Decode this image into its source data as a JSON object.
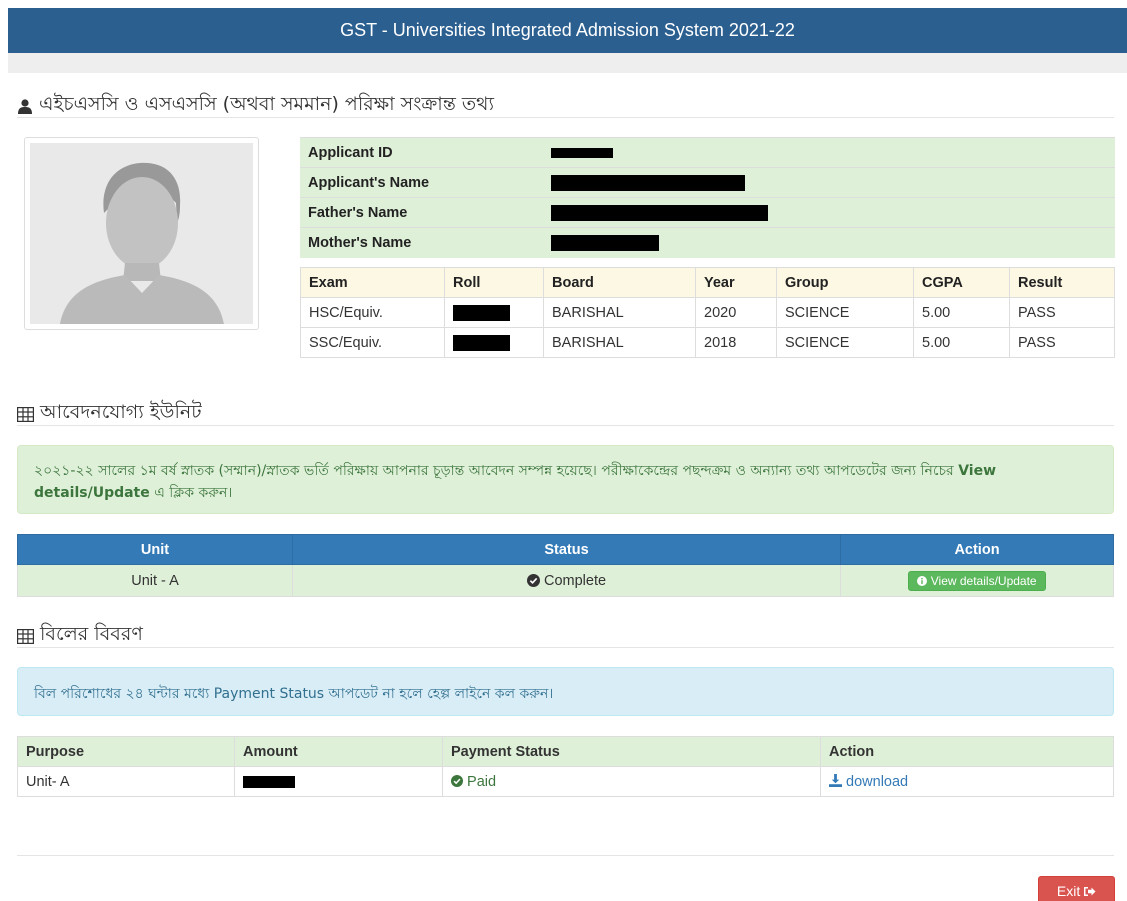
{
  "header": {
    "title": "GST - Universities Integrated Admission System 2021-22"
  },
  "exam_section": {
    "title": "এইচএসসি ও এসএসসি (অথবা সমমান) পরিক্ষা সংক্রান্ত তথ্য",
    "applicant_id_label": "Applicant ID",
    "applicant_name_label": "Applicant's Name",
    "father_name_label": "Father's Name",
    "mother_name_label": "Mother's Name",
    "columns": [
      "Exam",
      "Roll",
      "Board",
      "Year",
      "Group",
      "CGPA",
      "Result"
    ],
    "rows": [
      {
        "exam": "HSC/Equiv.",
        "board": "BARISHAL",
        "year": "2020",
        "group": "SCIENCE",
        "cgpa": "5.00",
        "result": "PASS"
      },
      {
        "exam": "SSC/Equiv.",
        "board": "BARISHAL",
        "year": "2018",
        "group": "SCIENCE",
        "cgpa": "5.00",
        "result": "PASS"
      }
    ]
  },
  "unit_section": {
    "title": "আবেদনযোগ্য ইউনিট",
    "notice": "২০২১-২২ সালের ১ম বর্ষ স্নাতক (সম্মান)/স্নাতক ভর্তি পরিক্ষায় আপনার চূড়ান্ত আবেদন সম্পন্ন হয়েছে। পরীক্ষাকেন্দ্রের পছন্দক্রম ও অন্যান্য তথ্য আপডেটের জন্য নিচের",
    "notice_link": "View details/Update",
    "notice_suffix": "এ ক্লিক করুন।",
    "columns": [
      "Unit",
      "Status",
      "Action"
    ],
    "rows": [
      {
        "unit": "Unit - A",
        "status": "Complete",
        "action": "View details/Update"
      }
    ]
  },
  "bill_section": {
    "title": "বিলের বিবরণ",
    "notice": "বিল পরিশোধের ২৪ ঘন্টার মধ্যে Payment Status আপডেট না হলে হেল্প লাইনে কল করুন।",
    "columns": [
      "Purpose",
      "Amount",
      "Payment Status",
      "Action"
    ],
    "rows": [
      {
        "purpose": "Unit- A",
        "status": "Paid",
        "action": "download"
      }
    ]
  },
  "footer": {
    "exit_label": "Exit"
  },
  "colors": {
    "header": "#2b5f90",
    "success_bg": "#dff0d8",
    "primary": "#337ab7",
    "danger": "#d9534f",
    "btn_success": "#5cb85c"
  }
}
